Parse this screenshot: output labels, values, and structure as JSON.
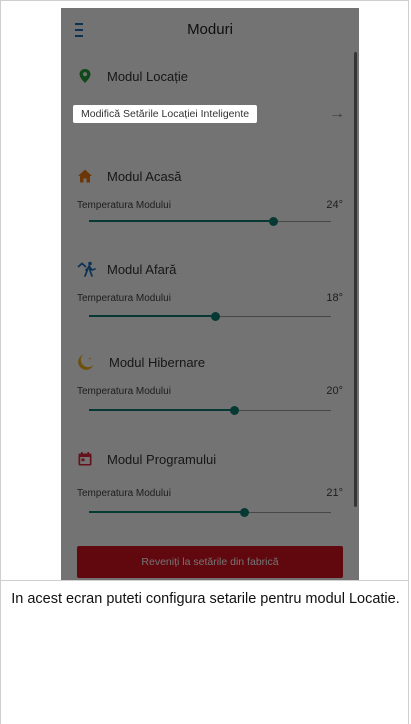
{
  "appbar": {
    "title": "Moduri",
    "menu_icon": "hamburger-icon"
  },
  "location": {
    "title": "Modul Locație",
    "icon": "location-pin-icon",
    "icon_color": "#27a03a",
    "action_label": "Modifică Setările Locației Inteligente",
    "action_icon": "arrow-right-icon"
  },
  "modes": [
    {
      "key": "acasa",
      "title": "Modul Acasă",
      "icon": "home-icon",
      "icon_color": "#f07a12",
      "temp_label": "Temperatura Modului",
      "temp_value": "24°",
      "level": 0.76
    },
    {
      "key": "afara",
      "title": "Modul Afară",
      "icon": "away-icon",
      "icon_color": "#1e6fb8",
      "temp_label": "Temperatura Modului",
      "temp_value": "18°",
      "level": 0.52
    },
    {
      "key": "hibernare",
      "title": "Modul Hibernare",
      "icon": "moon-icon",
      "icon_color": "#f2b21b",
      "temp_label": "Temperatura Modului",
      "temp_value": "20°",
      "level": 0.6
    },
    {
      "key": "programului",
      "title": "Modul Programului",
      "icon": "calendar-icon",
      "icon_color": "#e0253a",
      "temp_label": "Temperatura Modului",
      "temp_value": "21°",
      "level": 0.64
    }
  ],
  "reset_button": {
    "label": "Reveniți la setările din fabrică",
    "color": "#d8121f"
  },
  "caption": "In acest ecran puteti configura setarile pentru modul Locatie."
}
